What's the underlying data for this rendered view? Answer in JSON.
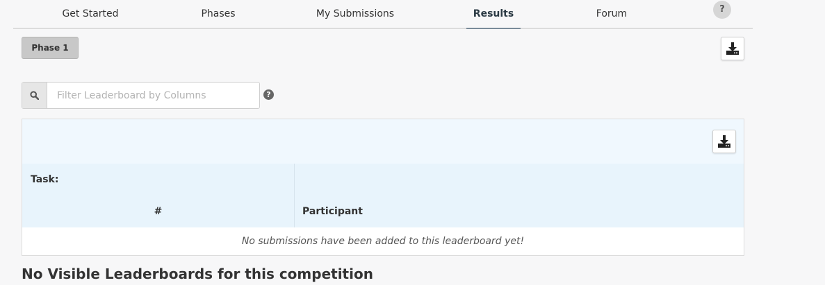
{
  "tabs": [
    {
      "label": "Get Started"
    },
    {
      "label": "Phases"
    },
    {
      "label": "My Submissions"
    },
    {
      "label": "Results",
      "active": true
    },
    {
      "label": "Forum"
    }
  ],
  "help_label": "?",
  "phase_button": {
    "label": "Phase 1"
  },
  "filter": {
    "placeholder": "Filter Leaderboard by Columns"
  },
  "filter_help": "?",
  "leaderboard": {
    "task_label": "Task:",
    "columns": [
      "#",
      "Participant"
    ],
    "empty_message": "No submissions have been added to this leaderboard yet!"
  },
  "no_leaderboards_heading": "No Visible Leaderboards for this competition",
  "icons": {
    "download": "download-icon",
    "search": "search-icon",
    "help": "question-icon"
  },
  "colors": {
    "accent": "#7a8b99",
    "table_header": "#e8f4fc",
    "phase_button": "#c8c8c8"
  }
}
